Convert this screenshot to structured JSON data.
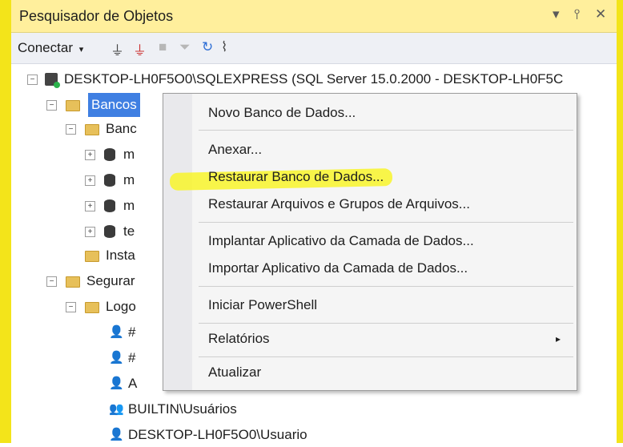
{
  "window": {
    "title": "Pesquisador de Objetos",
    "controls": [
      "▾",
      "⫯",
      "✕"
    ]
  },
  "toolbar": {
    "connect_label": "Conectar",
    "connect_arrow": "▾"
  },
  "tree": {
    "server": "DESKTOP-LH0F5O0\\SQLEXPRESS (SQL Server 15.0.2000 - DESKTOP-LH0F5C",
    "bancos": "Bancos",
    "banc": "Banc",
    "db_letters": [
      "m",
      "m",
      "m",
      "te"
    ],
    "insta": "Insta",
    "segurar": "Segurar",
    "logo": "Logo",
    "login_chars": [
      "#",
      "#",
      "A"
    ],
    "builtin": "BUILTIN\\Usuários",
    "desktop_user": "DESKTOP-LH0F5O0\\Usuario"
  },
  "context_menu": {
    "items": [
      "Novo Banco de Dados...",
      "Anexar...",
      "Restaurar Banco de Dados...",
      "Restaurar Arquivos e Grupos de Arquivos...",
      "Implantar Aplicativo da Camada de Dados...",
      "Importar Aplicativo da Camada de Dados...",
      "Iniciar PowerShell",
      "Relatórios",
      "Atualizar"
    ],
    "submenu_arrow": "▸"
  },
  "colors": {
    "frame": "#f3e41a",
    "title_bar": "#ffef9c",
    "selection": "#3f7fe2",
    "highlighter": "#f8f52a"
  }
}
